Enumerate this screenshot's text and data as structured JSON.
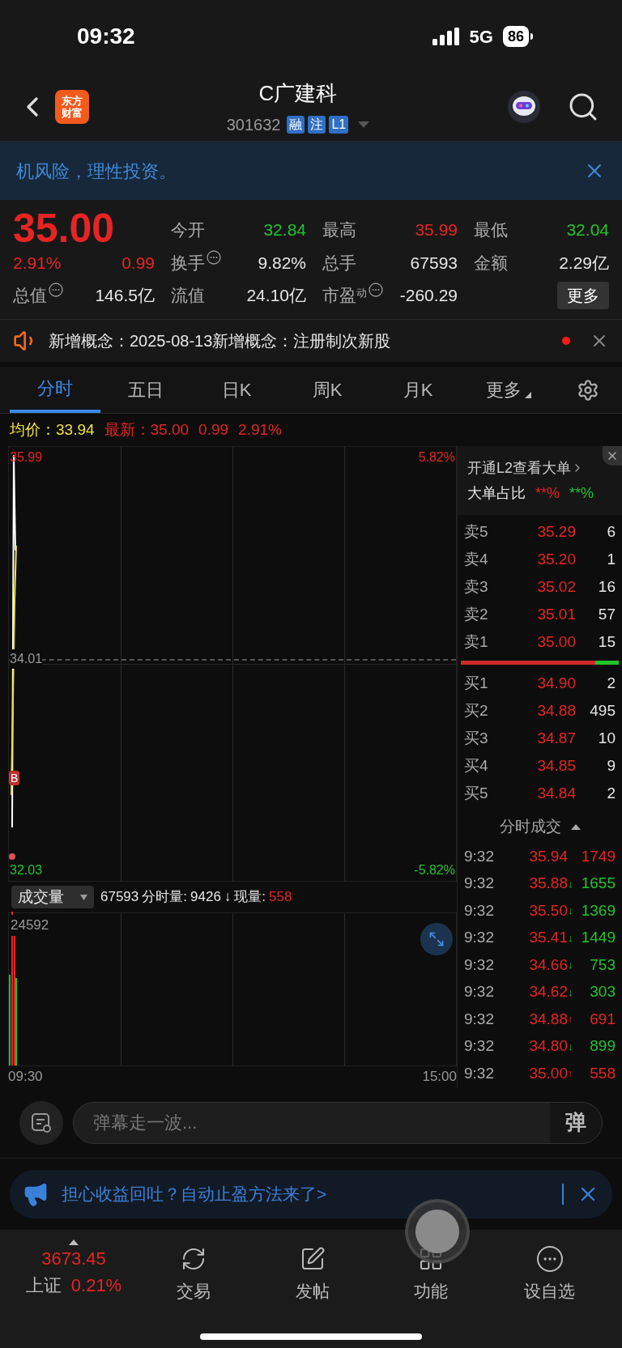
{
  "status_bar": {
    "time": "09:32",
    "network": "5G",
    "battery": "86"
  },
  "header": {
    "logo": [
      "东方",
      "财富"
    ],
    "title": "C广建科",
    "code": "301632",
    "badges": [
      "融",
      "注",
      "L1"
    ]
  },
  "risk_banner": {
    "text": "机风险，理性投资。"
  },
  "quote": {
    "price": "35.00",
    "change_pct": "2.91%",
    "change": "0.99",
    "stats": [
      {
        "label": "今开",
        "info": false,
        "value": "32.84",
        "color": "#22c32e"
      },
      {
        "label": "最高",
        "info": false,
        "value": "35.99",
        "color": "#e62424"
      },
      {
        "label": "最低",
        "info": false,
        "value": "32.04",
        "color": "#22c32e"
      },
      {
        "label": "换手",
        "info": true,
        "value": "9.82%",
        "color": "#e6e6e6"
      },
      {
        "label": "总手",
        "info": false,
        "value": "67593",
        "color": "#e6e6e6"
      },
      {
        "label": "金额",
        "info": false,
        "value": "2.29亿",
        "color": "#e6e6e6"
      },
      {
        "label": "总值",
        "info": true,
        "value": "146.5亿",
        "color": "#e6e6e6"
      },
      {
        "label": "流值",
        "info": false,
        "value": "24.10亿",
        "color": "#e6e6e6"
      },
      {
        "label": "市盈$^{动}$",
        "info": true,
        "value": "-260.29",
        "color": "#e6e6e6"
      }
    ],
    "more_button": "更多"
  },
  "concept": {
    "text": "新增概念：2025-08-13新增概念：注册制次新股",
    "unread": true
  },
  "tabs": [
    {
      "label": "分时",
      "selected": true
    },
    {
      "label": "五日",
      "selected": false
    },
    {
      "label": "日K",
      "selected": false
    },
    {
      "label": "周K",
      "selected": false
    },
    {
      "label": "月K",
      "selected": false
    },
    {
      "label": "更多",
      "selected": false
    }
  ],
  "summary": {
    "avg_label": "均价：",
    "avg": "33.94",
    "latest_label": "最新：",
    "latest": "35.00",
    "change": "0.99",
    "change_pct": "2.91%"
  },
  "price_chart": {
    "high": "35.99",
    "high_pct": "5.82%",
    "mid": "34.01",
    "low": "32.03",
    "low_pct": "-5.82%",
    "marker": "B"
  },
  "volume_chart": {
    "selector": "成交量",
    "total": "67593",
    "minute_label": "分时量:",
    "minute": "9426",
    "arrow": "↓",
    "current_label": "现量:",
    "current": "558",
    "max": "24592",
    "start": "09:30",
    "end": "15:00"
  },
  "level2": {
    "link": "开通L2查看大单",
    "ratio_label": "大单占比",
    "buy_ratio": "**%",
    "sell_ratio": "**%"
  },
  "asks": [
    {
      "label": "卖5",
      "price": "35.29",
      "qty": "6"
    },
    {
      "label": "卖4",
      "price": "35.20",
      "qty": "1"
    },
    {
      "label": "卖3",
      "price": "35.02",
      "qty": "16"
    },
    {
      "label": "卖2",
      "price": "35.01",
      "qty": "57"
    },
    {
      "label": "卖1",
      "price": "35.00",
      "qty": "15"
    }
  ],
  "book_balance": {
    "level": 0.85
  },
  "bids": [
    {
      "label": "买1",
      "price": "34.90",
      "qty": "2"
    },
    {
      "label": "买2",
      "price": "34.88",
      "qty": "495"
    },
    {
      "label": "买3",
      "price": "34.87",
      "qty": "10"
    },
    {
      "label": "买4",
      "price": "34.85",
      "qty": "9"
    },
    {
      "label": "买5",
      "price": "34.84",
      "qty": "2"
    }
  ],
  "trades_title": "分时成交",
  "trades": [
    {
      "time": "9:32",
      "price": "35.94",
      "qty": "1749",
      "kind": "buy"
    },
    {
      "time": "9:32",
      "price": "35.88",
      "arrow": "↓",
      "qty": "1655",
      "kind": "sell"
    },
    {
      "time": "9:32",
      "price": "35.50",
      "arrow": "↓",
      "qty": "1369",
      "kind": "sell"
    },
    {
      "time": "9:32",
      "price": "35.41",
      "arrow": "↓",
      "qty": "1449",
      "kind": "sell"
    },
    {
      "time": "9:32",
      "price": "34.66",
      "arrow": "↓",
      "qty": "753",
      "kind": "sell"
    },
    {
      "time": "9:32",
      "price": "34.62",
      "arrow": "↓",
      "qty": "303",
      "kind": "sell"
    },
    {
      "time": "9:32",
      "price": "34.88",
      "arrow": "↑",
      "qty": "691",
      "kind": "buy"
    },
    {
      "time": "9:32",
      "price": "34.80",
      "arrow": "↓",
      "qty": "899",
      "kind": "sell"
    },
    {
      "time": "9:32",
      "price": "35.00",
      "arrow": "↑",
      "qty": "558",
      "kind": "buy"
    }
  ],
  "barrage": {
    "placeholder": "弹幕走一波...",
    "toggle": "弹"
  },
  "promo": {
    "text": "担心收益回吐？自动止盈方法来了>"
  },
  "bottom_nav": {
    "index": {
      "value": "3673.45",
      "name": "上证",
      "pct": "0.21%"
    },
    "items": [
      {
        "label": "交易",
        "kind": "trade"
      },
      {
        "label": "发帖",
        "kind": "post"
      },
      {
        "label": "功能",
        "kind": "apps"
      },
      {
        "label": "设自选",
        "kind": "more"
      }
    ]
  }
}
